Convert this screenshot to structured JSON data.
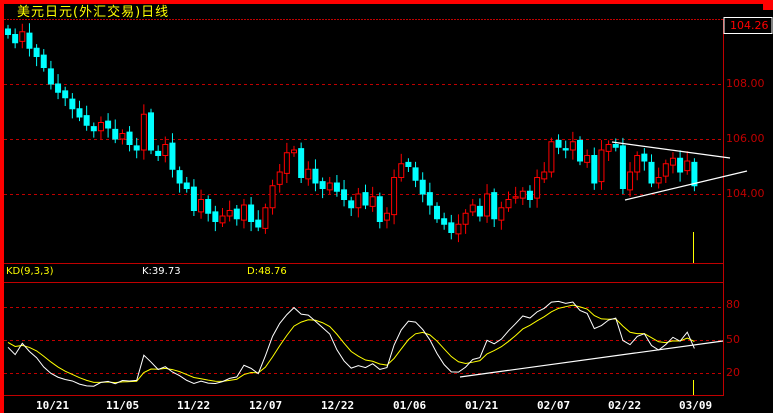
{
  "header": {
    "title": "美元日元(外汇交易)日线"
  },
  "price_panel": {
    "current_price": "104.26",
    "y_ticks": [
      "108.00",
      "106.00",
      "104.00"
    ],
    "y_tick_values": [
      108,
      106,
      104
    ],
    "closes": [
      109.8,
      109.5,
      109.9,
      109.3,
      109.0,
      108.6,
      108.0,
      107.7,
      107.5,
      107.1,
      106.8,
      106.5,
      106.3,
      106.6,
      106.4,
      106.0,
      106.2,
      105.8,
      105.6,
      106.9,
      105.6,
      105.4,
      105.8,
      104.9,
      104.4,
      104.2,
      103.4,
      103.8,
      103.3,
      103.0,
      103.2,
      103.4,
      103.1,
      103.6,
      103.0,
      102.8,
      103.5,
      104.3,
      104.8,
      105.5,
      105.6,
      104.6,
      104.9,
      104.4,
      104.2,
      104.4,
      104.1,
      103.8,
      103.5,
      104.0,
      103.6,
      103.9,
      103.0,
      103.3,
      104.6,
      105.1,
      105.0,
      104.5,
      104.0,
      103.6,
      103.1,
      102.9,
      102.6,
      102.9,
      103.3,
      103.6,
      103.2,
      104.0,
      103.1,
      103.5,
      103.8,
      103.9,
      104.1,
      103.8,
      104.6,
      104.8,
      105.9,
      105.7,
      105.6,
      105.9,
      105.2,
      105.4,
      104.4,
      105.6,
      105.8,
      105.7,
      104.2,
      104.8,
      105.4,
      105.2,
      104.4,
      104.6,
      105.1,
      105.3,
      104.8,
      105.2,
      104.3
    ],
    "colors": {
      "up": "#ff0000",
      "down": "#00ffff",
      "grid": "#c00000"
    }
  },
  "kd_panel": {
    "label": "KD(9,3,3)",
    "k_label": "K:39.73",
    "d_label": "D:48.76",
    "y_ticks": [
      "80",
      "50",
      "20"
    ],
    "y_tick_values": [
      80,
      50,
      20
    ],
    "colors": {
      "k": "#ffffff",
      "d": "#ffff00"
    }
  },
  "x_axis": {
    "dates": [
      "10/21",
      "11/05",
      "11/22",
      "12/07",
      "12/22",
      "01/06",
      "01/21",
      "02/07",
      "02/22",
      "03/09"
    ]
  }
}
